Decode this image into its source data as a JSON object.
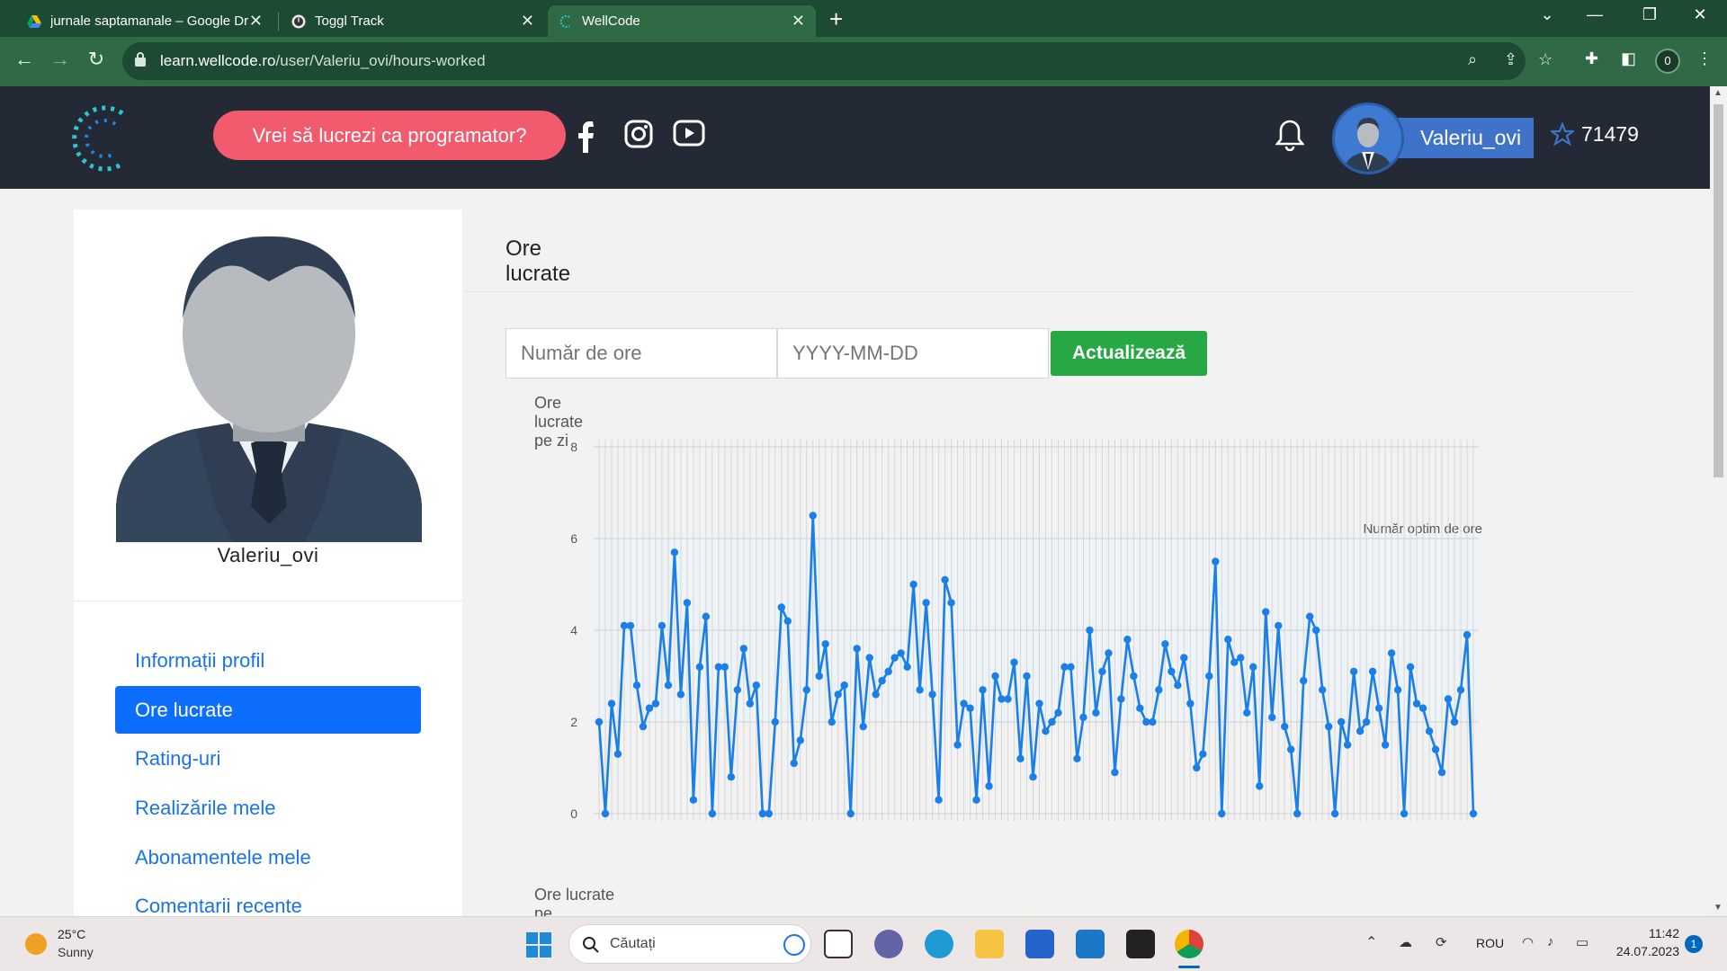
{
  "browser": {
    "tabs": [
      {
        "title": "jurnale saptamanale – Google Dr",
        "close": "✕"
      },
      {
        "title": "Toggl Track",
        "close": "✕"
      },
      {
        "title": "WellCode",
        "close": "✕"
      }
    ],
    "new_tab": "+",
    "url_host": "learn.wellcode.ro",
    "url_path": "/user/Valeriu_ovi/hours-worked",
    "profile_badge": "0",
    "window_controls": [
      "⌄",
      "—",
      "❐",
      "✕"
    ]
  },
  "header": {
    "cta": "Vrei să lucrezi ca programator?",
    "username": "Valeriu_ovi",
    "score": "71479",
    "colors": {
      "bg": "#232a35",
      "cta": "#f25a6e",
      "chip": "#3f72c9"
    }
  },
  "sidebar": {
    "username": "Valeriu_ovi",
    "items": [
      {
        "label": "Informații profil"
      },
      {
        "label": "Ore lucrate"
      },
      {
        "label": "Rating-uri"
      },
      {
        "label": "Realizările mele"
      },
      {
        "label": "Abonamentele mele"
      },
      {
        "label": "Comentarii recente"
      }
    ],
    "active_index": 1
  },
  "main": {
    "title": "Ore lucrate",
    "hours_placeholder": "Număr de ore",
    "date_placeholder": "YYYY-MM-DD",
    "update_label": "Actualizează",
    "chart1_label": "Ore lucrate pe zi",
    "chart2_label": "Ore lucrate pe săptămână"
  },
  "chart_data": {
    "type": "line",
    "title": "Ore lucrate pe zi",
    "ylim": [
      0,
      8
    ],
    "yticks": [
      0,
      2,
      4,
      6,
      8
    ],
    "grid": true,
    "band": {
      "from": 2,
      "to": 6,
      "label": "Număr optim de ore"
    },
    "series": [
      {
        "color": "#1a7fe8",
        "values": [
          2.0,
          0.0,
          2.4,
          1.3,
          4.1,
          4.1,
          2.8,
          1.9,
          2.3,
          2.4,
          4.1,
          2.8,
          5.7,
          2.6,
          4.6,
          0.3,
          3.2,
          4.3,
          0.0,
          3.2,
          3.2,
          0.8,
          2.7,
          3.6,
          2.4,
          2.8,
          0.0,
          0.0,
          2.0,
          4.5,
          4.2,
          1.1,
          1.6,
          2.7,
          6.5,
          3.0,
          3.7,
          2.0,
          2.6,
          2.8,
          0.0,
          3.6,
          1.9,
          3.4,
          2.6,
          2.9,
          3.1,
          3.4,
          3.5,
          3.2,
          5.0,
          2.7,
          4.6,
          2.6,
          0.3,
          5.1,
          4.6,
          1.5,
          2.4,
          2.3,
          0.3,
          2.7,
          0.6,
          3.0,
          2.5,
          2.5,
          3.3,
          1.2,
          3.0,
          0.8,
          2.4,
          1.8,
          2.0,
          2.2,
          3.2,
          3.2,
          1.2,
          2.1,
          4.0,
          2.2,
          3.1,
          3.5,
          0.9,
          2.5,
          3.8,
          3.0,
          2.3,
          2.0,
          2.0,
          2.7,
          3.7,
          3.1,
          2.8,
          3.4,
          2.4,
          1.0,
          1.3,
          3.0,
          5.5,
          0.0,
          3.8,
          3.3,
          3.4,
          2.2,
          3.2,
          0.6,
          4.4,
          2.1,
          4.1,
          1.9,
          1.4,
          0.0,
          2.9,
          4.3,
          4.0,
          2.7,
          1.9,
          0.0,
          2.0,
          1.5,
          3.1,
          1.8,
          2.0,
          3.1,
          2.3,
          1.5,
          3.5,
          2.7,
          0.0,
          3.2,
          2.4,
          2.3,
          1.8,
          1.4,
          0.9,
          2.5,
          2.0,
          2.7,
          3.9,
          0.0
        ]
      }
    ]
  },
  "taskbar": {
    "temp": "25°C",
    "weather": "Sunny",
    "search": "Căutați",
    "lang": "ROU",
    "time": "11:42",
    "date": "24.07.2023",
    "notifications": "1"
  }
}
